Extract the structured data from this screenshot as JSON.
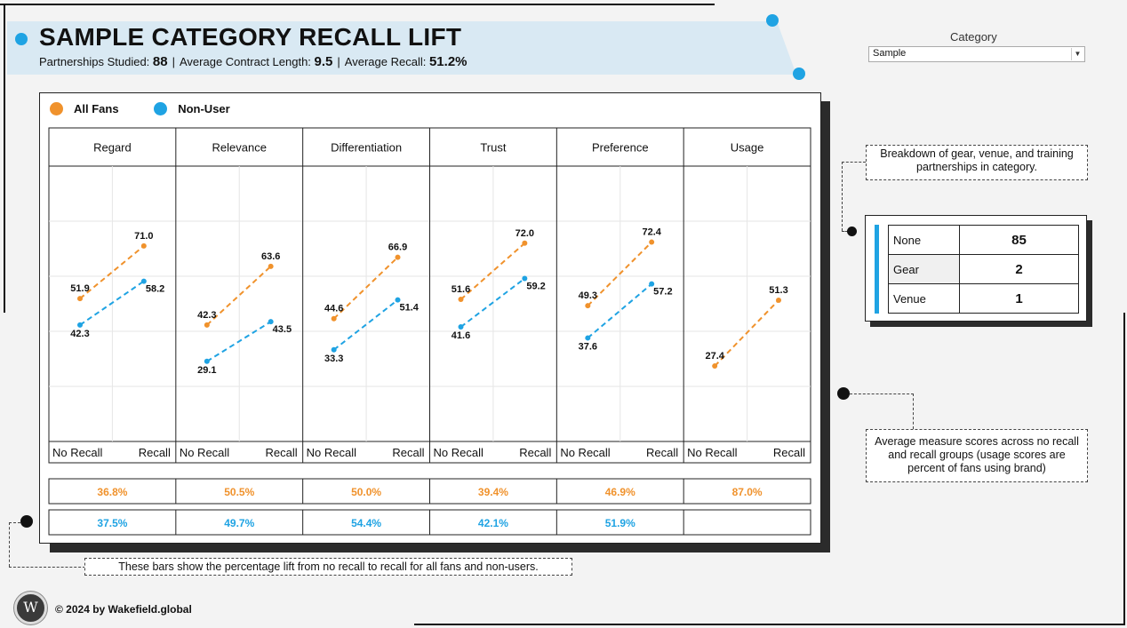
{
  "header": {
    "title": "SAMPLE CATEGORY RECALL LIFT",
    "partnerships_label": "Partnerships Studied:",
    "partnerships_value": "88",
    "contract_label": "Average Contract Length:",
    "contract_value": "9.5",
    "recall_label": "Average Recall:",
    "recall_value": "51.2%",
    "separator": "|"
  },
  "filter": {
    "label": "Category",
    "selected": "Sample"
  },
  "legend": [
    {
      "name": "All Fans",
      "color": "#f0922c"
    },
    {
      "name": "Non-User",
      "color": "#1fa3e3"
    }
  ],
  "chart_data": {
    "type": "line",
    "x": [
      "No Recall",
      "Recall"
    ],
    "panels": [
      {
        "name": "Regard",
        "all_fans": [
          51.9,
          71.0
        ],
        "non_user": [
          42.3,
          58.2
        ],
        "lift_all": "36.8%",
        "lift_non": "37.5%"
      },
      {
        "name": "Relevance",
        "all_fans": [
          42.3,
          63.6
        ],
        "non_user": [
          29.1,
          43.5
        ],
        "lift_all": "50.5%",
        "lift_non": "49.7%"
      },
      {
        "name": "Differentiation",
        "all_fans": [
          44.6,
          66.9
        ],
        "non_user": [
          33.3,
          51.4
        ],
        "lift_all": "50.0%",
        "lift_non": "54.4%"
      },
      {
        "name": "Trust",
        "all_fans": [
          51.6,
          72.0
        ],
        "non_user": [
          41.6,
          59.2
        ],
        "lift_all": "39.4%",
        "lift_non": "42.1%"
      },
      {
        "name": "Preference",
        "all_fans": [
          49.3,
          72.4
        ],
        "non_user": [
          37.6,
          57.2
        ],
        "lift_all": "46.9%",
        "lift_non": "51.9%"
      },
      {
        "name": "Usage",
        "all_fans": [
          27.4,
          51.3
        ],
        "non_user": null,
        "lift_all": "87.0%",
        "lift_non": ""
      }
    ],
    "series": [
      {
        "name": "All Fans",
        "key": "all_fans",
        "color": "#f0922c"
      },
      {
        "name": "Non-User",
        "key": "non_user",
        "color": "#1fa3e3"
      }
    ],
    "ylim": [
      0,
      100
    ],
    "grid": true,
    "line_style": "dashed"
  },
  "annotations": {
    "breakdown_note": "Breakdown of gear, venue, and training partnerships in category.",
    "measure_note": "Average measure scores across no recall and recall groups (usage scores are percent of fans using brand)",
    "lift_note": "These bars show the percentage lift from no recall to recall for all fans and non-users."
  },
  "breakdown": [
    {
      "label": "None",
      "value": "85"
    },
    {
      "label": "Gear",
      "value": "2"
    },
    {
      "label": "Venue",
      "value": "1"
    }
  ],
  "footer": {
    "logo_glyph": "W",
    "copyright": "© 2024 by Wakefield.global"
  }
}
